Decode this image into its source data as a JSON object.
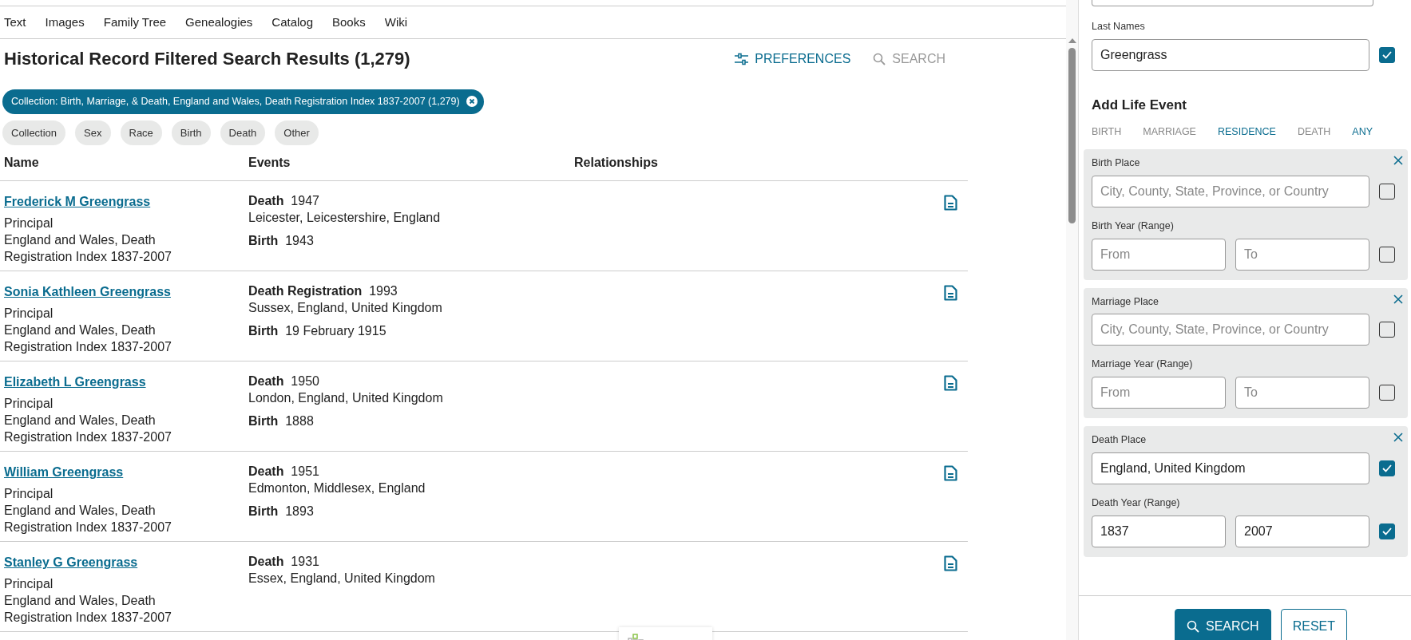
{
  "nav_tabs": [
    "Text",
    "Images",
    "Family Tree",
    "Genealogies",
    "Catalog",
    "Books",
    "Wiki"
  ],
  "title": "Historical Record Filtered Search Results (1,279)",
  "toolbar": [
    {
      "kind": "preferences",
      "label": "PREFERENCES",
      "disabled": false
    },
    {
      "kind": "search",
      "label": "SEARCH",
      "disabled": true
    }
  ],
  "active_filter": {
    "label": "Collection: Birth, Marriage, & Death, England and Wales, Death Registration Index 1837-2007 (1,279)"
  },
  "filter_pills": [
    "Collection",
    "Sex",
    "Race",
    "Birth",
    "Death",
    "Other"
  ],
  "table": {
    "columns": [
      "Name",
      "Events",
      "Relationships"
    ],
    "rows": [
      {
        "name": "Frederick M Greengrass",
        "role": "Principal",
        "collection": "England and Wales, Death Registration Index 1837-2007",
        "events": [
          {
            "type": "Death",
            "date": "1947",
            "place": "Leicester, Leicestershire, England"
          },
          {
            "type": "Birth",
            "date": "1943"
          }
        ]
      },
      {
        "name": "Sonia Kathleen Greengrass",
        "role": "Principal",
        "collection": "England and Wales, Death Registration Index 1837-2007",
        "events": [
          {
            "type": "Death Registration",
            "date": "1993",
            "place": "Sussex, England, United Kingdom"
          },
          {
            "type": "Birth",
            "date": "19 February 1915"
          }
        ]
      },
      {
        "name": "Elizabeth L Greengrass",
        "role": "Principal",
        "collection": "England and Wales, Death Registration Index 1837-2007",
        "events": [
          {
            "type": "Death",
            "date": "1950",
            "place": "London, England, United Kingdom"
          },
          {
            "type": "Birth",
            "date": "1888"
          }
        ]
      },
      {
        "name": "William Greengrass",
        "role": "Principal",
        "collection": "England and Wales, Death Registration Index 1837-2007",
        "events": [
          {
            "type": "Death",
            "date": "1951",
            "place": "Edmonton, Middlesex, England"
          },
          {
            "type": "Birth",
            "date": "1893"
          }
        ]
      },
      {
        "name": "Stanley G Greengrass",
        "role": "Principal",
        "collection": "England and Wales, Death Registration Index 1837-2007",
        "events": [
          {
            "type": "Death",
            "date": "1931",
            "place": "Essex, England, United Kingdom"
          }
        ]
      }
    ]
  },
  "search_form": {
    "last_names": {
      "label": "Last Names",
      "value": "Greengrass",
      "checked": true
    },
    "life_event_title": "Add Life Event",
    "life_event_tabs": [
      {
        "label": "BIRTH",
        "disabled": true
      },
      {
        "label": "MARRIAGE",
        "disabled": true
      },
      {
        "label": "RESIDENCE",
        "disabled": false
      },
      {
        "label": "DEATH",
        "disabled": true
      },
      {
        "label": "ANY",
        "disabled": false
      }
    ],
    "sections": [
      {
        "place_label": "Birth Place",
        "place": {
          "placeholder": "City, County, State, Province, or Country"
        },
        "place_checked": false,
        "year_label": "Birth Year (Range)",
        "from": {
          "placeholder": "From"
        },
        "to": {
          "placeholder": "To"
        },
        "year_checked": false
      },
      {
        "place_label": "Marriage Place",
        "place": {
          "placeholder": "City, County, State, Province, or Country"
        },
        "place_checked": false,
        "year_label": "Marriage Year (Range)",
        "from": {
          "placeholder": "From"
        },
        "to": {
          "placeholder": "To"
        },
        "year_checked": false
      },
      {
        "place_label": "Death Place",
        "place": {
          "value": "England, United Kingdom"
        },
        "place_checked": true,
        "year_label": "Death Year (Range)",
        "from": {
          "value": "1837"
        },
        "to": {
          "value": "2007"
        },
        "year_checked": true
      }
    ],
    "buttons": [
      {
        "kind": "primary",
        "label": "SEARCH"
      },
      {
        "kind": "secondary",
        "label": "RESET"
      }
    ]
  }
}
